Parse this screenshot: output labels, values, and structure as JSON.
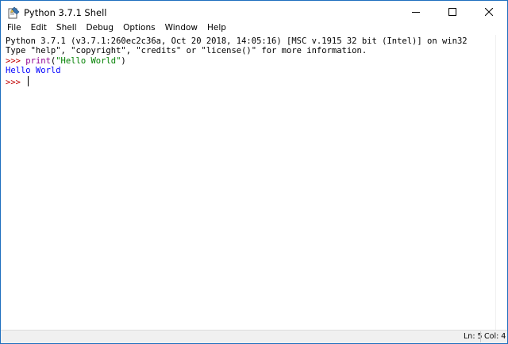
{
  "window": {
    "title": "Python 3.7.1 Shell",
    "icon": "python-idle-icon",
    "controls": {
      "minimize": "minimize-icon",
      "maximize": "maximize-icon",
      "close": "close-icon"
    }
  },
  "menubar": {
    "items": [
      "File",
      "Edit",
      "Shell",
      "Debug",
      "Options",
      "Window",
      "Help"
    ]
  },
  "shell": {
    "banner_line1": "Python 3.7.1 (v3.7.1:260ec2c36a, Oct 20 2018, 14:05:16) [MSC v.1915 32 bit (Intel)] on win32",
    "banner_line2": "Type \"help\", \"copyright\", \"credits\" or \"license()\" for more information.",
    "prompt": ">>> ",
    "command_builtin": "print",
    "command_open": "(",
    "command_string": "\"Hello World\"",
    "command_close": ")",
    "output": "Hello World",
    "current_prompt": ">>> "
  },
  "statusbar": {
    "ln": "Ln: 5",
    "col": "Col: 4"
  },
  "colors": {
    "prompt": "#c00000",
    "builtin": "#900090",
    "string": "#008000",
    "stdout": "#0000ff",
    "window_border": "#1e6fbf"
  }
}
